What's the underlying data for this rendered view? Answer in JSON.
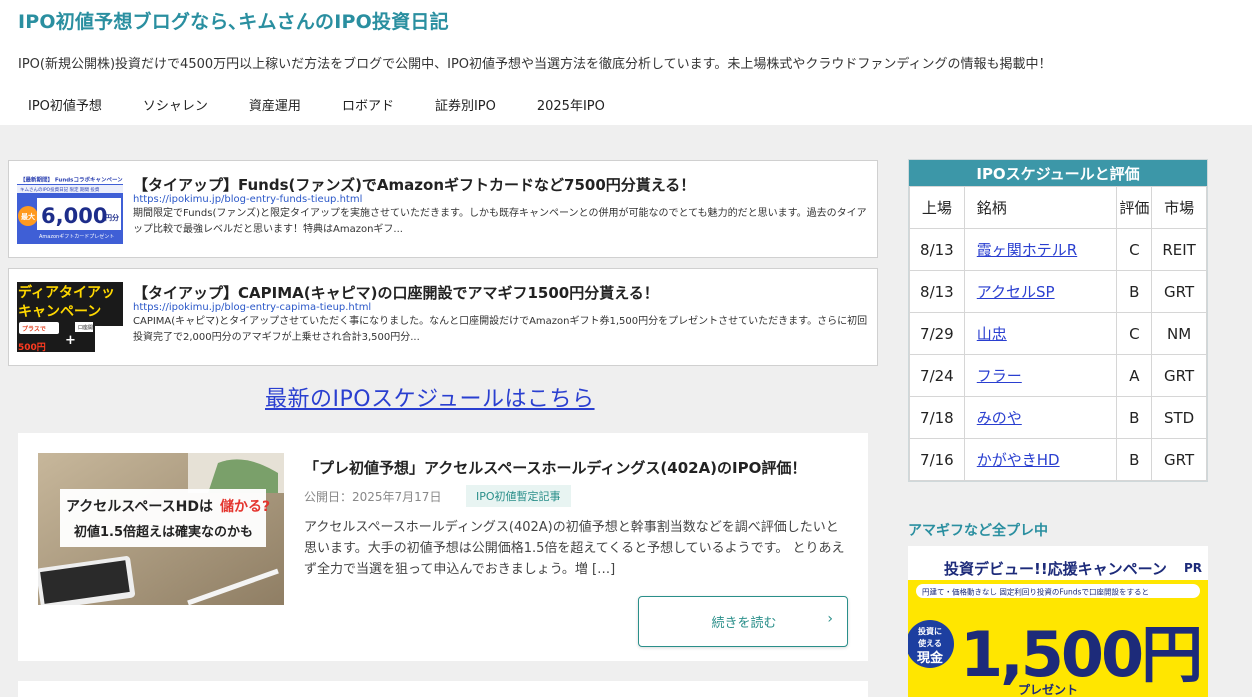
{
  "site": {
    "title": "IPO初値予想ブログなら､キムさんのIPO投資日記",
    "description": "IPO(新規公開株)投資だけで4500万円以上稼いだ方法をブログで公開中、IPO初値予想や当選方法を徹底分析しています。未上場株式やクラウドファンディングの情報も掲載中！"
  },
  "nav": [
    "IPO初値予想",
    "ソシャレン",
    "資産運用",
    "ロボアド",
    "証券別IPO",
    "2025年IPO"
  ],
  "tieups": [
    {
      "title": "【タイアップ】Funds(ファンズ)でAmazonギフトカードなど7500円分貰える！",
      "url": "https://ipokimu.jp/blog-entry-funds-tieup.html",
      "excerpt": "期間限定でFunds(ファンズ)と限定タイアップを実施させていただきます。しかも既存キャンペーンとの併用が可能なのでとても魅力的だと思います。過去のタイアップ比較で最強レベルだと思います！特典はAmazonギフ...",
      "thumb": {
        "top": "【最新期間】 Fundsコラボキャンペーン",
        "line2": "キムさんのIPO投資日記 限定 期間 投資",
        "badge": "最大",
        "amount": "6,000",
        "unit": "円分",
        "bottom": "Amazonギフトカードプレゼント"
      }
    },
    {
      "title": "【タイアップ】CAPIMA(キャピマ)の口座開設でアマギフ1500円分貰える！",
      "url": "https://ipokimu.jp/blog-entry-capima-tieup.html",
      "excerpt": "CAPIMA(キャピマ)とタイアップさせていただく事になりました。なんと口座開設だけでAmazonギフト券1,500円分をプレゼントさせていただきます。さらに初回投資完了で2,000円分のアマギフが上乗せされ合計3,500円分...",
      "thumb": {
        "line1": "ディアタイアッ",
        "line2": "キャンペーン",
        "small": "プラスで",
        "box": "口座開設で",
        "plus": "+",
        "amount": "500円"
      }
    }
  ],
  "schedule_link": "最新のIPOスケジュールはこちら",
  "article": {
    "title": "「プレ初値予想」アクセルスペースホールディングス(402A)のIPO評価！",
    "date": "公開日：2025年7月17日",
    "category": "IPO初値暫定記事",
    "excerpt": "アクセルスペースホールディングス(402A)の初値予想と幹事割当数などを調べ評価したいと思います。大手の初値予想は公開価格1.5倍を超えてくると予想しているようです。 とりあえず全力で当選を狙って申込んでおきましょう。増 […]",
    "thumb_line1": "アクセルスペースHDは",
    "thumb_hl": "儲かる?",
    "thumb_line2": "初値1.5倍超えは確実なのかも",
    "more": "続きを読む"
  },
  "schedule": {
    "title": "IPOスケジュールと評価",
    "headers": [
      "上場",
      "銘柄",
      "評価",
      "市場"
    ],
    "rows": [
      [
        "8/13",
        "霞ヶ関ホテルR",
        "C",
        "REIT"
      ],
      [
        "8/13",
        "アクセルSP",
        "B",
        "GRT"
      ],
      [
        "7/29",
        "山忠",
        "C",
        "NM"
      ],
      [
        "7/24",
        "フラー",
        "A",
        "GRT"
      ],
      [
        "7/18",
        "みのや",
        "B",
        "STD"
      ],
      [
        "7/16",
        "かがやきHD",
        "B",
        "GRT"
      ]
    ]
  },
  "sidebar_banner": {
    "title": "アマギフなど全プレ中",
    "headline": "投資デビュー!!応援キャンペーン",
    "pr": "PR",
    "sub": "円建て・価格動きなし 固定利回り投資のFundsで口座開設をすると",
    "badge_top": "投資に",
    "badge_mid": "使える",
    "badge_big": "現金",
    "amount": "1,500円",
    "tail": "プレゼント"
  },
  "colors": {
    "accent": "#2a8fa0",
    "link": "#2a3fd0",
    "table_head": "#3c97a8",
    "banner_yellow": "#ffe600"
  }
}
